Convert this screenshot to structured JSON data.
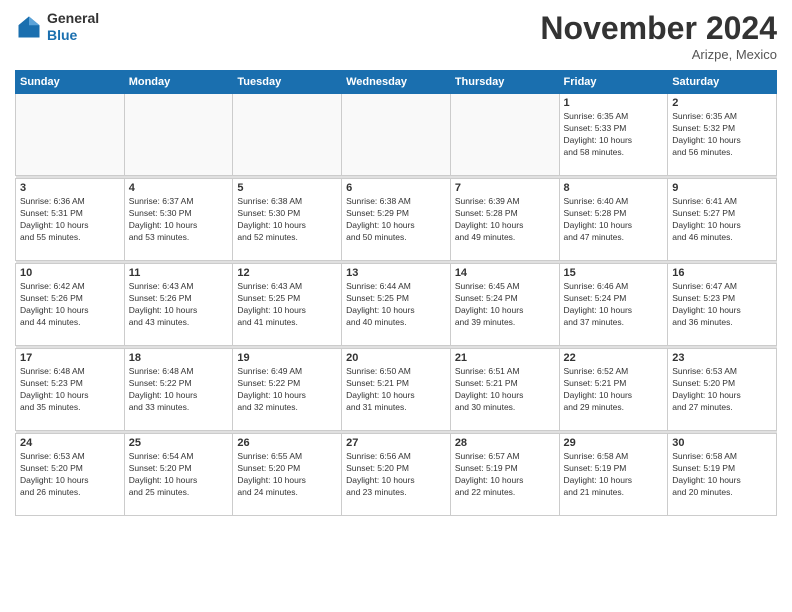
{
  "header": {
    "logo_general": "General",
    "logo_blue": "Blue",
    "month_title": "November 2024",
    "location": "Arizpe, Mexico"
  },
  "days_of_week": [
    "Sunday",
    "Monday",
    "Tuesday",
    "Wednesday",
    "Thursday",
    "Friday",
    "Saturday"
  ],
  "weeks": [
    {
      "days": [
        {
          "num": "",
          "info": ""
        },
        {
          "num": "",
          "info": ""
        },
        {
          "num": "",
          "info": ""
        },
        {
          "num": "",
          "info": ""
        },
        {
          "num": "",
          "info": ""
        },
        {
          "num": "1",
          "info": "Sunrise: 6:35 AM\nSunset: 5:33 PM\nDaylight: 10 hours\nand 58 minutes."
        },
        {
          "num": "2",
          "info": "Sunrise: 6:35 AM\nSunset: 5:32 PM\nDaylight: 10 hours\nand 56 minutes."
        }
      ]
    },
    {
      "days": [
        {
          "num": "3",
          "info": "Sunrise: 6:36 AM\nSunset: 5:31 PM\nDaylight: 10 hours\nand 55 minutes."
        },
        {
          "num": "4",
          "info": "Sunrise: 6:37 AM\nSunset: 5:30 PM\nDaylight: 10 hours\nand 53 minutes."
        },
        {
          "num": "5",
          "info": "Sunrise: 6:38 AM\nSunset: 5:30 PM\nDaylight: 10 hours\nand 52 minutes."
        },
        {
          "num": "6",
          "info": "Sunrise: 6:38 AM\nSunset: 5:29 PM\nDaylight: 10 hours\nand 50 minutes."
        },
        {
          "num": "7",
          "info": "Sunrise: 6:39 AM\nSunset: 5:28 PM\nDaylight: 10 hours\nand 49 minutes."
        },
        {
          "num": "8",
          "info": "Sunrise: 6:40 AM\nSunset: 5:28 PM\nDaylight: 10 hours\nand 47 minutes."
        },
        {
          "num": "9",
          "info": "Sunrise: 6:41 AM\nSunset: 5:27 PM\nDaylight: 10 hours\nand 46 minutes."
        }
      ]
    },
    {
      "days": [
        {
          "num": "10",
          "info": "Sunrise: 6:42 AM\nSunset: 5:26 PM\nDaylight: 10 hours\nand 44 minutes."
        },
        {
          "num": "11",
          "info": "Sunrise: 6:43 AM\nSunset: 5:26 PM\nDaylight: 10 hours\nand 43 minutes."
        },
        {
          "num": "12",
          "info": "Sunrise: 6:43 AM\nSunset: 5:25 PM\nDaylight: 10 hours\nand 41 minutes."
        },
        {
          "num": "13",
          "info": "Sunrise: 6:44 AM\nSunset: 5:25 PM\nDaylight: 10 hours\nand 40 minutes."
        },
        {
          "num": "14",
          "info": "Sunrise: 6:45 AM\nSunset: 5:24 PM\nDaylight: 10 hours\nand 39 minutes."
        },
        {
          "num": "15",
          "info": "Sunrise: 6:46 AM\nSunset: 5:24 PM\nDaylight: 10 hours\nand 37 minutes."
        },
        {
          "num": "16",
          "info": "Sunrise: 6:47 AM\nSunset: 5:23 PM\nDaylight: 10 hours\nand 36 minutes."
        }
      ]
    },
    {
      "days": [
        {
          "num": "17",
          "info": "Sunrise: 6:48 AM\nSunset: 5:23 PM\nDaylight: 10 hours\nand 35 minutes."
        },
        {
          "num": "18",
          "info": "Sunrise: 6:48 AM\nSunset: 5:22 PM\nDaylight: 10 hours\nand 33 minutes."
        },
        {
          "num": "19",
          "info": "Sunrise: 6:49 AM\nSunset: 5:22 PM\nDaylight: 10 hours\nand 32 minutes."
        },
        {
          "num": "20",
          "info": "Sunrise: 6:50 AM\nSunset: 5:21 PM\nDaylight: 10 hours\nand 31 minutes."
        },
        {
          "num": "21",
          "info": "Sunrise: 6:51 AM\nSunset: 5:21 PM\nDaylight: 10 hours\nand 30 minutes."
        },
        {
          "num": "22",
          "info": "Sunrise: 6:52 AM\nSunset: 5:21 PM\nDaylight: 10 hours\nand 29 minutes."
        },
        {
          "num": "23",
          "info": "Sunrise: 6:53 AM\nSunset: 5:20 PM\nDaylight: 10 hours\nand 27 minutes."
        }
      ]
    },
    {
      "days": [
        {
          "num": "24",
          "info": "Sunrise: 6:53 AM\nSunset: 5:20 PM\nDaylight: 10 hours\nand 26 minutes."
        },
        {
          "num": "25",
          "info": "Sunrise: 6:54 AM\nSunset: 5:20 PM\nDaylight: 10 hours\nand 25 minutes."
        },
        {
          "num": "26",
          "info": "Sunrise: 6:55 AM\nSunset: 5:20 PM\nDaylight: 10 hours\nand 24 minutes."
        },
        {
          "num": "27",
          "info": "Sunrise: 6:56 AM\nSunset: 5:20 PM\nDaylight: 10 hours\nand 23 minutes."
        },
        {
          "num": "28",
          "info": "Sunrise: 6:57 AM\nSunset: 5:19 PM\nDaylight: 10 hours\nand 22 minutes."
        },
        {
          "num": "29",
          "info": "Sunrise: 6:58 AM\nSunset: 5:19 PM\nDaylight: 10 hours\nand 21 minutes."
        },
        {
          "num": "30",
          "info": "Sunrise: 6:58 AM\nSunset: 5:19 PM\nDaylight: 10 hours\nand 20 minutes."
        }
      ]
    }
  ]
}
